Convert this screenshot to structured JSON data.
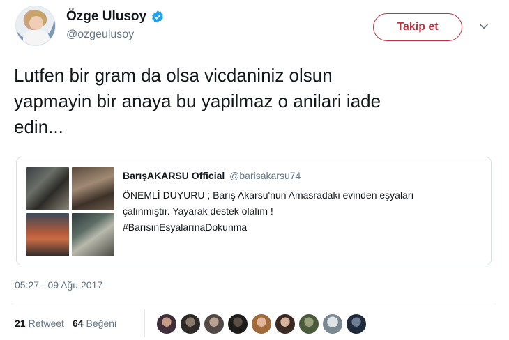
{
  "author": {
    "display_name": "Özge Ulusoy",
    "handle": "@ozgeulusoy",
    "verified_icon": "verified-badge-icon"
  },
  "follow_button": {
    "label": "Takip et"
  },
  "menu_icon": "chevron-down-icon",
  "tweet": {
    "line1": "Lutfen bir gram da olsa vicdaniniz olsun",
    "line2": "yapmayin bir anaya bu yapilmaz o anilari iade",
    "line3": "edin..."
  },
  "quoted_tweet": {
    "name": "BarışAKARSU Official",
    "handle": "@barisakarsu74",
    "line1": "ÖNEMLİ DUYURU ; Barış Akarsu'nun Amasradaki evinden eşyaları",
    "line2": "çalınmıştır. Yayarak destek olalım !",
    "line3": "#BarısınEsyalarınaDokunma"
  },
  "timestamp": "05:27 - 09 Ağu 2017",
  "stats": {
    "retweet_count": "21",
    "retweet_label": "Retweet",
    "like_count": "64",
    "like_label": "Beğeni"
  },
  "colors": {
    "follow_accent": "#c0343f",
    "verified_blue": "#1da1f2",
    "secondary_text": "#657786"
  }
}
